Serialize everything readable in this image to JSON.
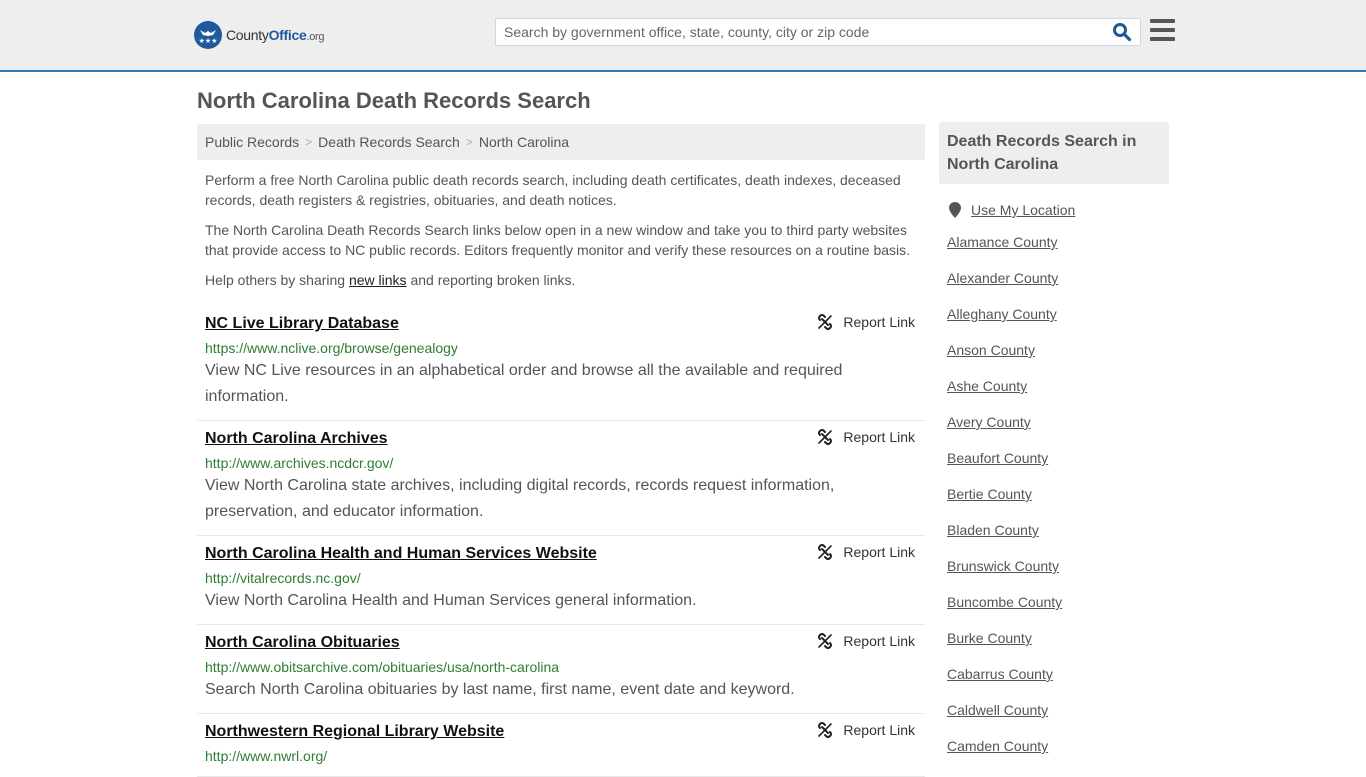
{
  "header": {
    "logo": {
      "part1": "County",
      "part2": "Office",
      "part3": ".org"
    },
    "search_placeholder": "Search by government office, state, county, city or zip code",
    "search_value": "",
    "search_icon": "search-icon",
    "menu_icon": "hamburger-menu-icon"
  },
  "page_title": "North Carolina Death Records Search",
  "breadcrumb": [
    {
      "label": "Public Records"
    },
    {
      "label": "Death Records Search"
    },
    {
      "label": "North Carolina"
    }
  ],
  "breadcrumb_separator": ">",
  "intro": {
    "p1": "Perform a free North Carolina public death records search, including death certificates, death indexes, deceased records, death registers & registries, obituaries, and death notices.",
    "p2": "The North Carolina Death Records Search links below open in a new window and take you to third party websites that provide access to NC public records. Editors frequently monitor and verify these resources on a routine basis.",
    "p3_before": "Help others by sharing ",
    "p3_link": "new links",
    "p3_after": " and reporting broken links."
  },
  "report_label": "Report Link",
  "results": [
    {
      "title": "NC Live Library Database",
      "url": "https://www.nclive.org/browse/genealogy",
      "desc": "View NC Live resources in an alphabetical order and browse all the available and required information."
    },
    {
      "title": "North Carolina Archives",
      "url": "http://www.archives.ncdcr.gov/",
      "desc": "View North Carolina state archives, including digital records, records request information, preservation, and educator information."
    },
    {
      "title": "North Carolina Health and Human Services Website",
      "url": "http://vitalrecords.nc.gov/",
      "desc": "View North Carolina Health and Human Services general information."
    },
    {
      "title": "North Carolina Obituaries",
      "url": "http://www.obitsarchive.com/obituaries/usa/north-carolina",
      "desc": "Search North Carolina obituaries by last name, first name, event date and keyword."
    },
    {
      "title": "Northwestern Regional Library Website",
      "url": "http://www.nwrl.org/",
      "desc": ""
    }
  ],
  "sidebar": {
    "heading": "Death Records Search in North Carolina",
    "use_location": "Use My Location",
    "counties": [
      "Alamance County",
      "Alexander County",
      "Alleghany County",
      "Anson County",
      "Ashe County",
      "Avery County",
      "Beaufort County",
      "Bertie County",
      "Bladen County",
      "Brunswick County",
      "Buncombe County",
      "Burke County",
      "Cabarrus County",
      "Caldwell County",
      "Camden County"
    ]
  },
  "colors": {
    "brand_blue": "#1f5a9c",
    "header_border": "#2e7bb4",
    "url_green": "#2e7d32",
    "header_bg": "#eeeeee"
  }
}
